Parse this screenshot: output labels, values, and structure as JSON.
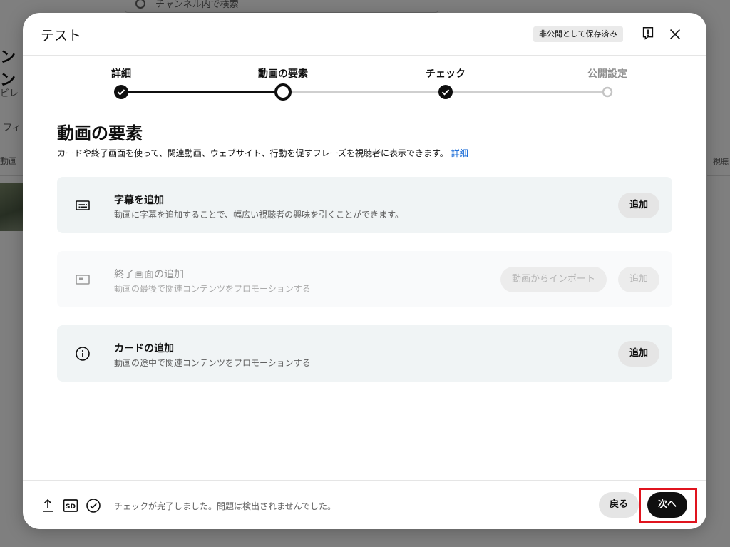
{
  "background": {
    "search_placeholder": "チャンネル内で検索",
    "left_title": "ンン",
    "left_text1": "ビレ",
    "left_text2": "フィ",
    "left_text3": "動画",
    "right_text": "視聴"
  },
  "dialog": {
    "title": "テスト",
    "saved_badge": "非公開として保存済み"
  },
  "stepper": {
    "steps": [
      {
        "label": "詳細",
        "state": "done"
      },
      {
        "label": "動画の要素",
        "state": "current"
      },
      {
        "label": "チェック",
        "state": "done"
      },
      {
        "label": "公開設定",
        "state": "upcoming"
      }
    ]
  },
  "content": {
    "heading": "動画の要素",
    "description": "カードや終了画面を使って、関連動画、ウェブサイト、行動を促すフレーズを視聴者に表示できます。",
    "details_link": "詳細",
    "cards": [
      {
        "title": "字幕を追加",
        "subtitle": "動画に字幕を追加することで、幅広い視聴者の興味を引くことができます。",
        "button": "追加",
        "icon": "subtitles-icon",
        "disabled": false
      },
      {
        "title": "終了画面の追加",
        "subtitle": "動画の最後で関連コンテンツをプロモーションする",
        "button": "追加",
        "secondary_button": "動画からインポート",
        "icon": "end-screen-icon",
        "disabled": true
      },
      {
        "title": "カードの追加",
        "subtitle": "動画の途中で関連コンテンツをプロモーションする",
        "button": "追加",
        "icon": "info-icon",
        "disabled": false
      }
    ]
  },
  "footer": {
    "status": "チェックが完了しました。問題は検出されませんでした。",
    "quality_badge": "SD",
    "back_label": "戻る",
    "next_label": "次へ"
  },
  "colors": {
    "accent_link": "#065fd4",
    "primary_button": "#0f0f0f",
    "highlight": "#e0141e",
    "card_bg": "#f0f4f5"
  }
}
